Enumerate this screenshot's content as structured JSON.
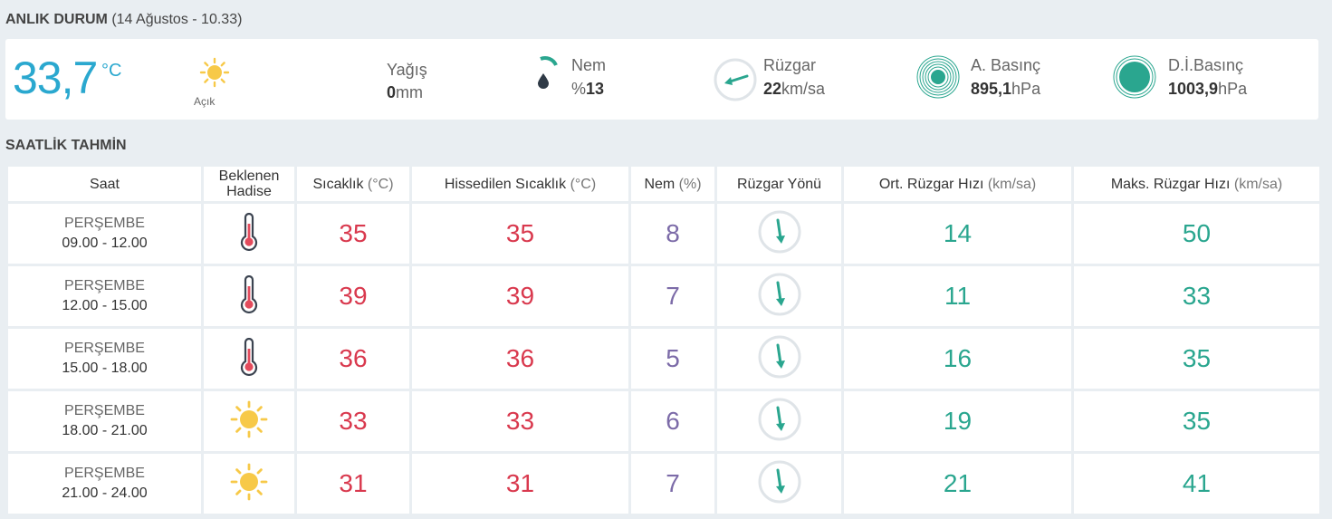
{
  "current": {
    "section_title": "ANLIK DURUM",
    "section_sub": "(14 Ağustos - 10.33)",
    "temperature": "33,7",
    "temperature_unit": "°C",
    "sky_icon": "sun-icon",
    "sky_label": "Açık",
    "precip": {
      "label": "Yağış",
      "value": "0",
      "unit": "mm"
    },
    "humidity": {
      "label": "Nem",
      "prefix": "%",
      "value": "13",
      "icon": "humidity-drop-icon",
      "level_percent": 13
    },
    "wind": {
      "label": "Rüzgar",
      "value": "22",
      "unit": "km/sa",
      "icon": "wind-direction-icon"
    },
    "pressure": {
      "label": "A. Basınç",
      "value": "895,1",
      "unit": "hPa",
      "icon": "pressure-icon"
    },
    "sea_pressure": {
      "label": "D.İ.Basınç",
      "value": "1003,9",
      "unit": "hPa",
      "icon": "sea-pressure-icon"
    }
  },
  "hourly": {
    "section_title": "SAATLİK TAHMİN",
    "headers": [
      {
        "text": "Saat",
        "unit": ""
      },
      {
        "text": "Beklenen Hadise",
        "unit": ""
      },
      {
        "text": "Sıcaklık",
        "unit": "(°C)"
      },
      {
        "text": "Hissedilen Sıcaklık",
        "unit": "(°C)"
      },
      {
        "text": "Nem",
        "unit": "(%)"
      },
      {
        "text": "Rüzgar Yönü",
        "unit": ""
      },
      {
        "text": "Ort. Rüzgar Hızı",
        "unit": "(km/sa)"
      },
      {
        "text": "Maks. Rüzgar Hızı",
        "unit": "(km/sa)"
      }
    ],
    "rows": [
      {
        "day": "PERŞEMBE",
        "time": "09.00 - 12.00",
        "icon": "thermometer-icon",
        "temp": "35",
        "feels": "35",
        "humidity": "8",
        "wind_dir_icon": "wind-arrow-icon",
        "avg_wind": "14",
        "max_wind": "50"
      },
      {
        "day": "PERŞEMBE",
        "time": "12.00 - 15.00",
        "icon": "thermometer-icon",
        "temp": "39",
        "feels": "39",
        "humidity": "7",
        "wind_dir_icon": "wind-arrow-icon",
        "avg_wind": "11",
        "max_wind": "33"
      },
      {
        "day": "PERŞEMBE",
        "time": "15.00 - 18.00",
        "icon": "thermometer-icon",
        "temp": "36",
        "feels": "36",
        "humidity": "5",
        "wind_dir_icon": "wind-arrow-icon",
        "avg_wind": "16",
        "max_wind": "35"
      },
      {
        "day": "PERŞEMBE",
        "time": "18.00 - 21.00",
        "icon": "sun-icon",
        "temp": "33",
        "feels": "33",
        "humidity": "6",
        "wind_dir_icon": "wind-arrow-icon",
        "avg_wind": "19",
        "max_wind": "35"
      },
      {
        "day": "PERŞEMBE",
        "time": "21.00 - 24.00",
        "icon": "sun-icon",
        "temp": "31",
        "feels": "31",
        "humidity": "7",
        "wind_dir_icon": "wind-arrow-icon",
        "avg_wind": "21",
        "max_wind": "41"
      }
    ]
  },
  "colors": {
    "temperature_blue": "#2aa8cf",
    "hot_red": "#d9394e",
    "humidity_purple": "#7c6ba8",
    "wind_green": "#2aa68f",
    "sun_yellow": "#f7c948",
    "background": "#e9eef2"
  }
}
